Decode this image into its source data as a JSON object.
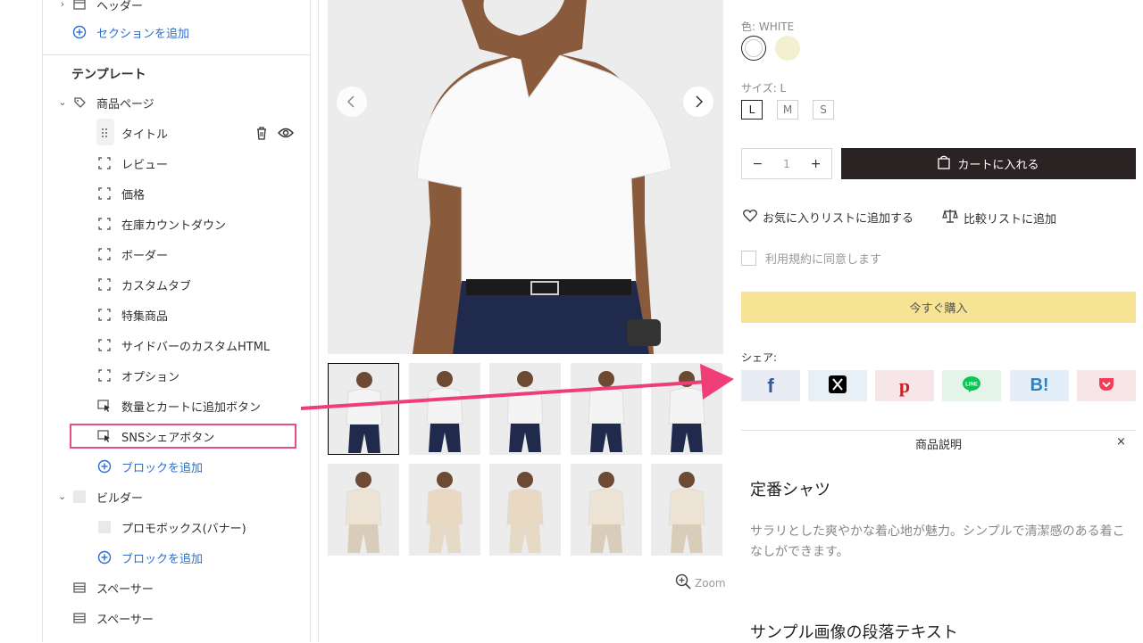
{
  "sidebar": {
    "header_item": "ヘッダー",
    "add_section": "セクションを追加",
    "template_heading": "テンプレート",
    "product_page": "商品ページ",
    "blocks": [
      {
        "label": "タイトル"
      },
      {
        "label": "レビュー"
      },
      {
        "label": "価格"
      },
      {
        "label": "在庫カウントダウン"
      },
      {
        "label": "ボーダー"
      },
      {
        "label": "カスタムタブ"
      },
      {
        "label": "特集商品"
      },
      {
        "label": "サイドバーのカスタムHTML"
      },
      {
        "label": "オプション"
      },
      {
        "label": "数量とカートに追加ボタン"
      },
      {
        "label": "SNSシェアボタン"
      }
    ],
    "add_block": "ブロックを追加",
    "builder": "ビルダー",
    "promo_box": "プロモボックス(バナー)",
    "add_block_2": "ブロックを追加",
    "spacer_1": "スペーサー",
    "spacer_2": "スペーサー"
  },
  "gallery": {
    "zoom_label": "Zoom"
  },
  "product": {
    "color_label": "色:",
    "color_value": "WHITE",
    "size_label": "サイズ:",
    "size_value": "L",
    "sizes": [
      "L",
      "M",
      "S"
    ],
    "quantity": "1",
    "add_to_cart": "カートに入れる",
    "wishlist": "お気に入りリストに追加する",
    "compare": "比較リストに追加",
    "terms": "利用規約に同意します",
    "buy_now": "今すぐ購入",
    "share_label": "シェア:",
    "description_tab": "商品説明",
    "description_close": "×",
    "description_title": "定番シャツ",
    "description_body": "サラリとした爽やかな着心地が魅力。シンプルで清潔感のある着こなしができます。",
    "sample_heading": "サンプル画像の段落テキスト"
  },
  "colors": {
    "highlight": "#e84b86",
    "cart_bg": "#2b2224",
    "buy_now_bg": "#f7e394",
    "link_blue": "#2c6ecb"
  }
}
